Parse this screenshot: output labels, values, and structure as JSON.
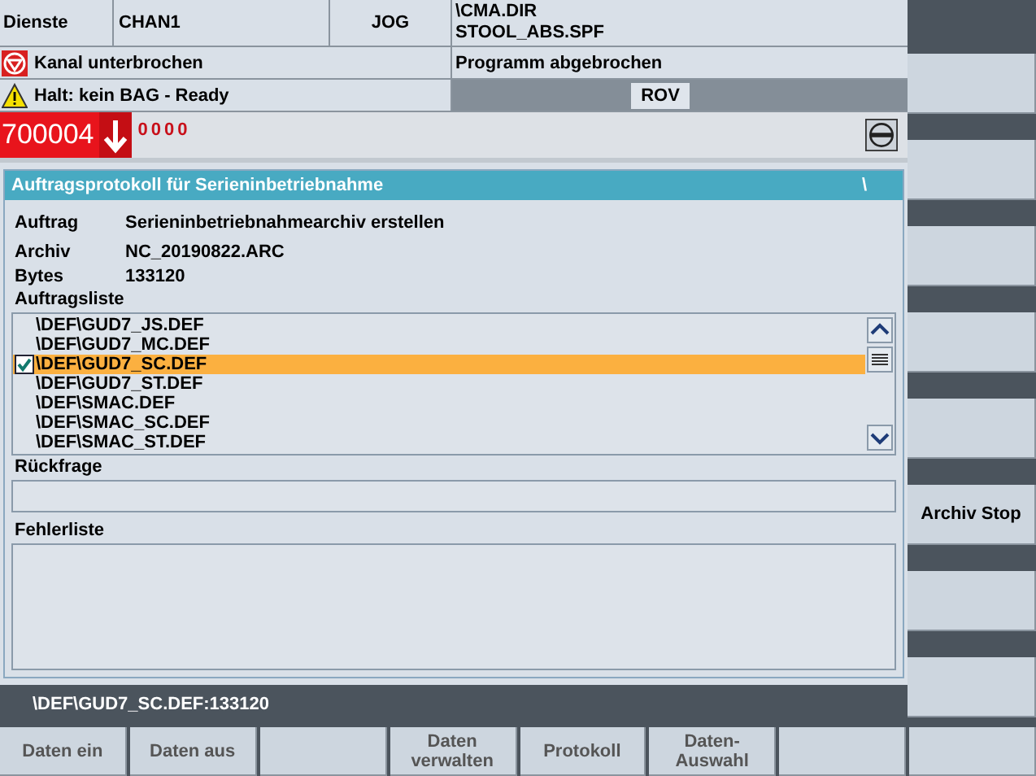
{
  "header": {
    "area": "Dienste",
    "channel": "CHAN1",
    "mode": "JOG",
    "program_path": [
      "\\CMA.DIR",
      "STOOL_ABS.SPF"
    ],
    "channel_status": "Kanal unterbrochen",
    "program_status": "Programm abgebrochen",
    "alarm_message": "Halt: kein BAG - Ready",
    "rov": "ROV"
  },
  "alarm": {
    "number": "700004",
    "counter": "0000"
  },
  "panel": {
    "title": "Auftragsprotokoll für Serieninbetriebnahme",
    "title_path": "\\",
    "fields": [
      {
        "label": "Auftrag",
        "value": "Serieninbetriebnahmearchiv erstellen"
      },
      {
        "label": "Archiv",
        "value": "NC_20190822.ARC"
      },
      {
        "label": "Bytes",
        "value": "133120"
      }
    ],
    "list_label": "Auftragsliste",
    "list_items": [
      {
        "text": "\\DEF\\GUD7_JS.DEF",
        "selected": false,
        "checked": false
      },
      {
        "text": "\\DEF\\GUD7_MC.DEF",
        "selected": false,
        "checked": false
      },
      {
        "text": "\\DEF\\GUD7_SC.DEF",
        "selected": true,
        "checked": true
      },
      {
        "text": "\\DEF\\GUD7_ST.DEF",
        "selected": false,
        "checked": false
      },
      {
        "text": "\\DEF\\SMAC.DEF",
        "selected": false,
        "checked": false
      },
      {
        "text": "\\DEF\\SMAC_SC.DEF",
        "selected": false,
        "checked": false
      },
      {
        "text": "\\DEF\\SMAC_ST.DEF",
        "selected": false,
        "checked": false
      }
    ],
    "query_label": "Rückfrage",
    "error_label": "Fehlerliste"
  },
  "status_line": "\\DEF\\GUD7_SC.DEF:133120",
  "vertical_softkeys": [
    {
      "kind": "blank"
    },
    {
      "kind": "blank"
    },
    {
      "kind": "blank"
    },
    {
      "kind": "blank"
    },
    {
      "kind": "blank"
    },
    {
      "kind": "label",
      "label": "Archiv Stop"
    },
    {
      "kind": "blank"
    },
    {
      "kind": "blank"
    }
  ],
  "horizontal_softkeys": [
    {
      "kind": "label",
      "label": "Daten ein"
    },
    {
      "kind": "label",
      "label": "Daten aus"
    },
    {
      "kind": "blank"
    },
    {
      "kind": "label",
      "label": "Daten verwalten"
    },
    {
      "kind": "label",
      "label": "Protokoll"
    },
    {
      "kind": "label",
      "label": "Daten-Auswahl"
    },
    {
      "kind": "blank"
    },
    {
      "kind": "blank"
    }
  ]
}
